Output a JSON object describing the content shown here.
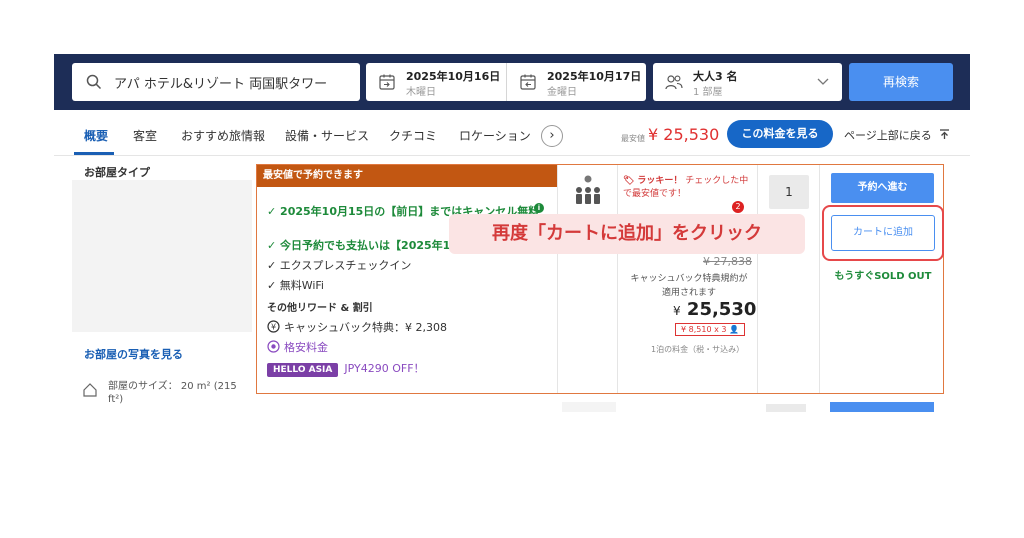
{
  "search": {
    "destination": "アパ ホテル&リゾート 両国駅タワー",
    "checkin_date": "2025年10月16日",
    "checkin_day": "木曜日",
    "checkout_date": "2025年10月17日",
    "checkout_day": "金曜日",
    "guests": "大人3 名",
    "rooms": "1 部屋",
    "button": "再検索"
  },
  "nav": {
    "tabs": [
      "概要",
      "客室",
      "おすすめ旅情報",
      "設備・サービス",
      "クチコミ",
      "ロケーション"
    ],
    "next_glyph": "›",
    "lowest_label": "最安値",
    "lowest_price": "¥ 25,530",
    "rate_button": "この料金を見る",
    "page_top": "ページ上部に戻る"
  },
  "room": {
    "type_header": "お部屋タイプ",
    "photo_link": "お部屋の写真を見る",
    "size": "部屋のサイズ： 20 m² (215 ft²)"
  },
  "deal": {
    "header": "最安値で予約できます",
    "perks": [
      "2025年10月15日の【前日】まではキャンセル無料",
      "今日予約でも支払いは【2025年1",
      "エクスプレスチェックイン",
      "無料WiFi"
    ],
    "info_badge": "i",
    "rewards_header": "その他リワード & 割引",
    "cashback": "キャッシュバック特典：¥ 2,308",
    "discount_label": "格安料金",
    "hello_badge": "HELLO ASIA",
    "hello_text": "JPY4290 OFF！",
    "lucky_title": "ラッキー！",
    "lucky_text": "チェックした中で最安値です！",
    "lucky_count": "2",
    "old_price": "¥ 27,838",
    "cashback_note": "キャッシュバック特典規約が適用されます",
    "price_symbol": "¥",
    "price": "25,530",
    "price_breakdown": "¥ 8,510 x 3",
    "per_night": "1泊の料金（税・サ込み）",
    "quantity": "1",
    "reserve_button": "予約へ進む",
    "cart_button": "カートに追加",
    "soldout": "もうすぐSOLD OUT"
  },
  "annotation": {
    "callout": "再度「カートに追加」をクリック"
  },
  "colors": {
    "header_bg": "#1d2d57",
    "primary_blue": "#4a8ff0",
    "deal_header": "#c25712",
    "highlight_red": "#e6484a",
    "green": "#1d8a3a"
  }
}
